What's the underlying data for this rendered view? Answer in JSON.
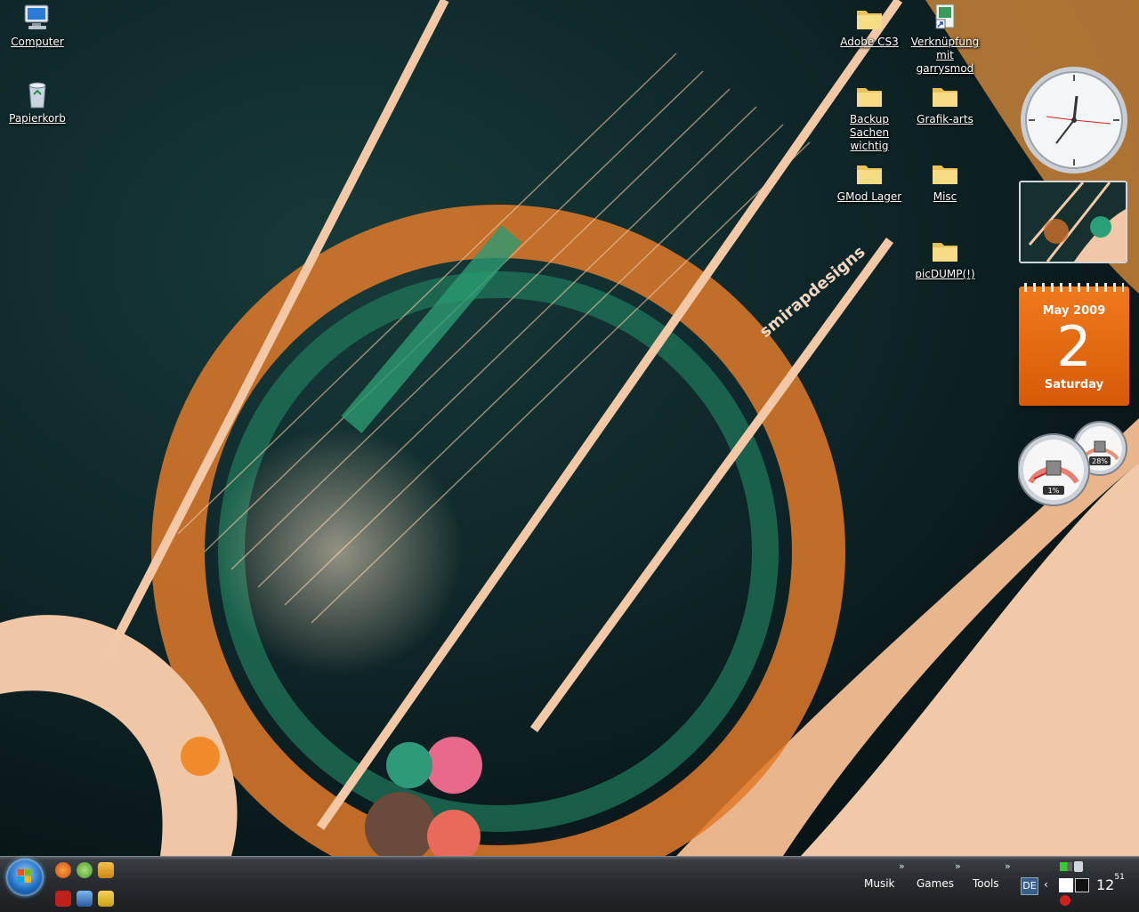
{
  "desktop": {
    "icons": [
      {
        "id": "computer",
        "label": "Computer",
        "icon": "computer-icon"
      },
      {
        "id": "recycle",
        "label": "Papierkorb",
        "icon": "recycle-bin-icon"
      },
      {
        "id": "adobe",
        "label": "Adobe CS3",
        "icon": "folder-icon"
      },
      {
        "id": "garrysmod",
        "label": "Verknüpfung mit garrysmod",
        "icon": "shortcut-icon"
      },
      {
        "id": "backup",
        "label": "Backup Sachen wichtig",
        "icon": "folder-icon"
      },
      {
        "id": "grafik",
        "label": "Grafik-arts",
        "icon": "folder-icon"
      },
      {
        "id": "gmod",
        "label": "GMod Lager",
        "icon": "folder-icon"
      },
      {
        "id": "misc",
        "label": "Misc",
        "icon": "folder-icon"
      },
      {
        "id": "picdump",
        "label": "picDUMP(!)",
        "icon": "folder-icon"
      }
    ],
    "wallpaper_text": "smirapdesigns"
  },
  "gadgets": {
    "calendar": {
      "month": "May 2009",
      "day": "2",
      "weekday": "Saturday"
    },
    "cpu_meter": {
      "cpu": "1%",
      "memory": "28%",
      "cpu_value": 1,
      "memory_value": 28
    }
  },
  "taskbar": {
    "toolbars": [
      "Musik",
      "Games",
      "Tools"
    ],
    "chevron": "»",
    "language": "DE",
    "clock": {
      "hour": "12",
      "minute": "51"
    },
    "colors": {
      "accent": "#1d6bc1",
      "calendar": "#e8690f"
    }
  }
}
